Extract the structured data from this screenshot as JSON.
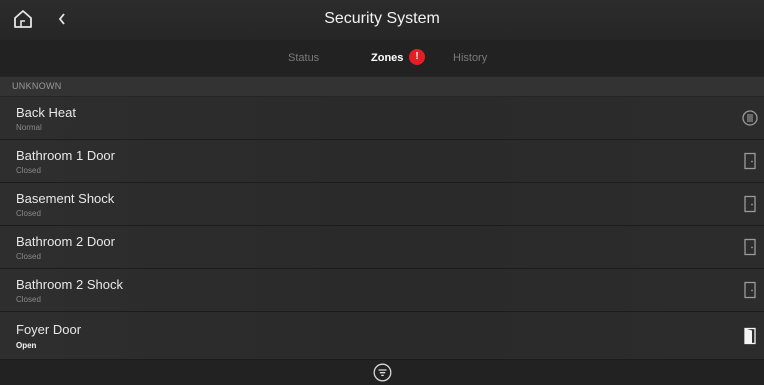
{
  "header": {
    "title": "Security System",
    "home_icon": "home-icon",
    "back_icon": "chevron-left-icon"
  },
  "tabs": [
    {
      "label": "Status",
      "active": false
    },
    {
      "label": "Zones",
      "active": true,
      "badge": "!"
    },
    {
      "label": "History",
      "active": false
    }
  ],
  "section": {
    "label": "UNKNOWN"
  },
  "zones": [
    {
      "name": "Back Heat",
      "status": "Normal",
      "icon": "heat-sensor-icon"
    },
    {
      "name": "Bathroom 1 Door",
      "status": "Closed",
      "icon": "door-closed-icon"
    },
    {
      "name": "Basement Shock",
      "status": "Closed",
      "icon": "door-closed-icon"
    },
    {
      "name": "Bathroom 2 Door",
      "status": "Closed",
      "icon": "door-closed-icon"
    },
    {
      "name": "Bathroom 2 Shock",
      "status": "Closed",
      "icon": "door-closed-icon"
    },
    {
      "name": "Foyer Door",
      "status": "Open",
      "icon": "door-open-icon"
    }
  ],
  "footer": {
    "filter_icon": "filter-icon"
  },
  "colors": {
    "alert": "#e31e24",
    "background": "#262626"
  }
}
